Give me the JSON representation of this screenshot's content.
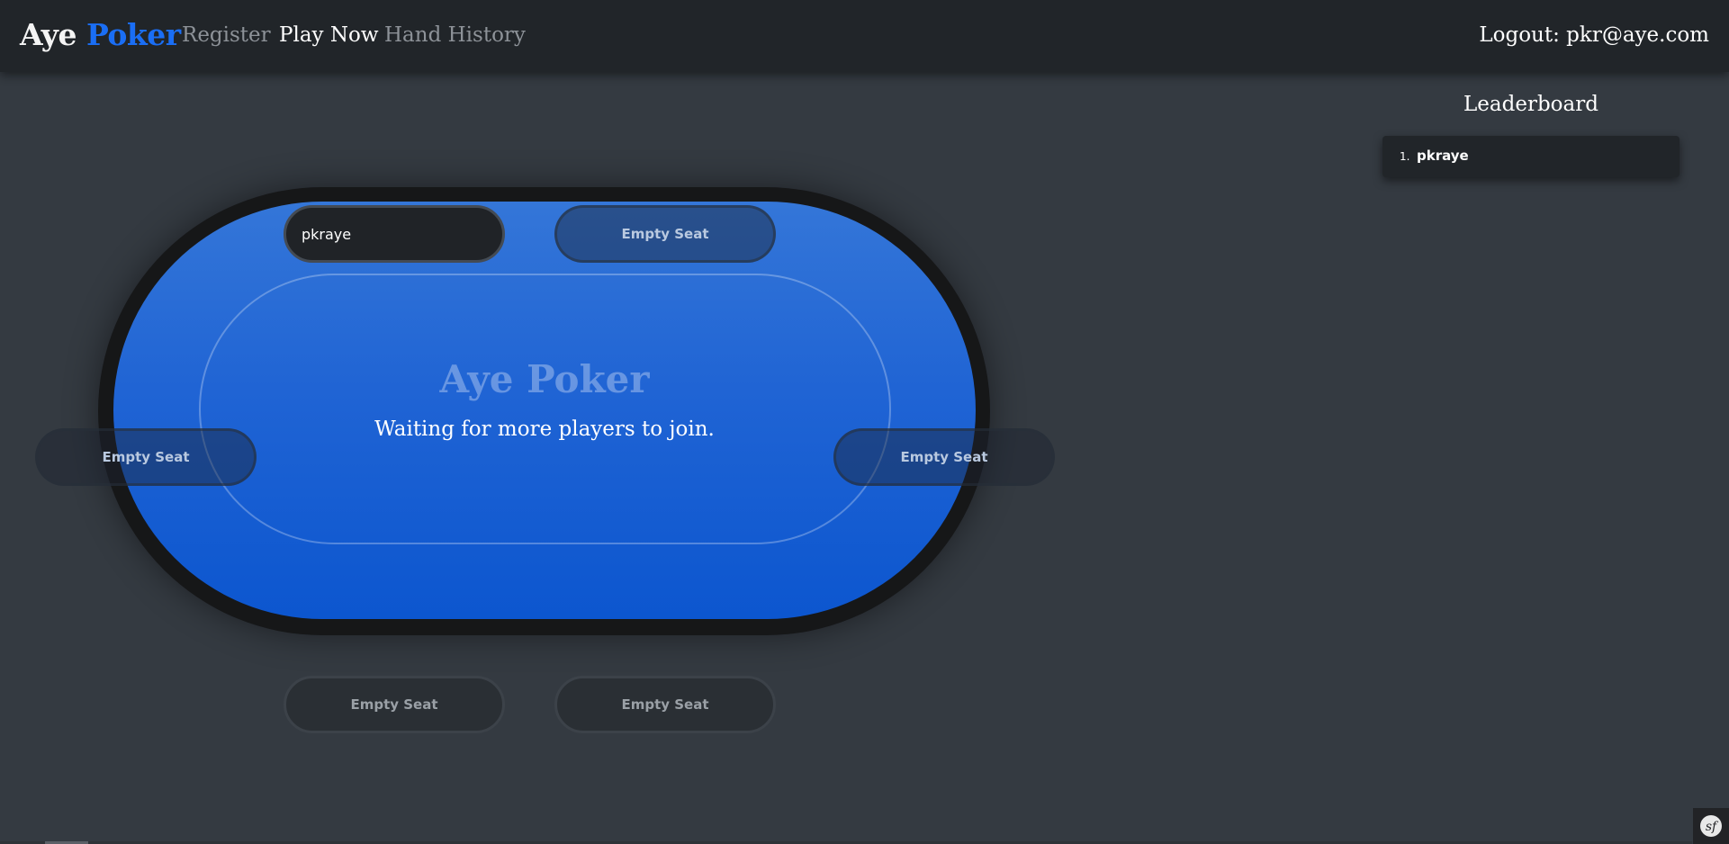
{
  "navbar": {
    "brand": {
      "part1": "Aye",
      "part2": "Poker"
    },
    "links": [
      {
        "label": "Register",
        "active": false
      },
      {
        "label": "Play Now",
        "active": true
      },
      {
        "label": "Hand History",
        "active": false
      }
    ],
    "logout": "Logout: pkr@aye.com"
  },
  "table": {
    "title": "Aye Poker",
    "status": "Waiting for more players to join.",
    "seats": [
      {
        "label": "pkraye",
        "occupied": true
      },
      {
        "label": "Empty Seat",
        "occupied": false
      },
      {
        "label": "Empty Seat",
        "occupied": false
      },
      {
        "label": "Empty Seat",
        "occupied": false
      },
      {
        "label": "Empty Seat",
        "occupied": false
      },
      {
        "label": "Empty Seat",
        "occupied": false
      }
    ]
  },
  "leaderboard": {
    "title": "Leaderboard",
    "entries": [
      {
        "rank": "1.",
        "name": "pkraye"
      }
    ]
  },
  "colors": {
    "background": "#343a41",
    "navbar": "#212529",
    "brand_accent": "#1a6ef5",
    "felt_top": "#3476d8",
    "felt_bottom": "#0c56cf"
  },
  "icons": {
    "debug_toolbar": "symfony-icon"
  }
}
